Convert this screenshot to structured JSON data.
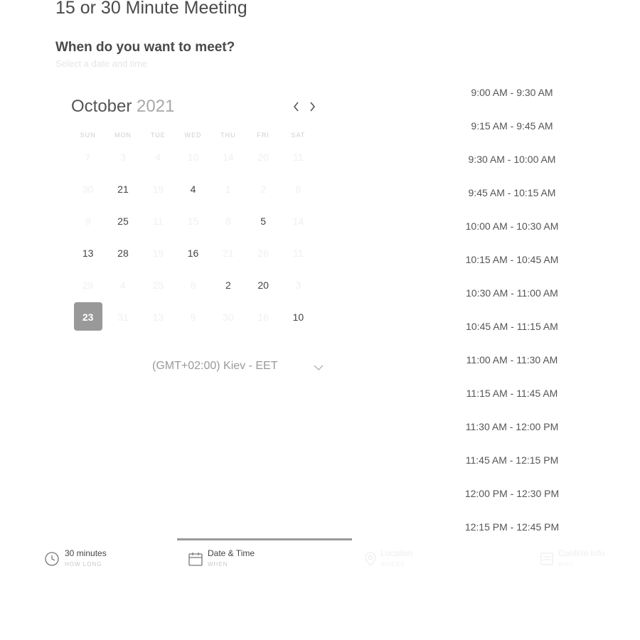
{
  "meeting": {
    "title": "15 or 30 Minute Meeting",
    "question": "When do you want to meet?",
    "subtitle": "Select a date and time"
  },
  "calendar": {
    "month": "October",
    "year": "2021",
    "prev_icon": "chevron-left-icon",
    "next_icon": "chevron-right-icon",
    "weekdays": [
      "SUN",
      "MON",
      "TUE",
      "WED",
      "THU",
      "FRI",
      "SAT"
    ],
    "days": [
      {
        "label": "7",
        "state": "disabled"
      },
      {
        "label": "3",
        "state": "disabled"
      },
      {
        "label": "4",
        "state": "disabled"
      },
      {
        "label": "10",
        "state": "disabled"
      },
      {
        "label": "14",
        "state": "disabled"
      },
      {
        "label": "20",
        "state": "disabled"
      },
      {
        "label": "11",
        "state": "disabled"
      },
      {
        "label": "30",
        "state": "disabled"
      },
      {
        "label": "21",
        "state": "enabled"
      },
      {
        "label": "19",
        "state": "disabled"
      },
      {
        "label": "4",
        "state": "enabled"
      },
      {
        "label": "1",
        "state": "disabled"
      },
      {
        "label": "2",
        "state": "disabled"
      },
      {
        "label": "8",
        "state": "disabled"
      },
      {
        "label": "9",
        "state": "disabled"
      },
      {
        "label": "25",
        "state": "enabled"
      },
      {
        "label": "11",
        "state": "disabled"
      },
      {
        "label": "15",
        "state": "disabled"
      },
      {
        "label": "8",
        "state": "disabled"
      },
      {
        "label": "5",
        "state": "enabled"
      },
      {
        "label": "14",
        "state": "disabled"
      },
      {
        "label": "13",
        "state": "enabled"
      },
      {
        "label": "28",
        "state": "enabled"
      },
      {
        "label": "19",
        "state": "disabled"
      },
      {
        "label": "16",
        "state": "enabled"
      },
      {
        "label": "21",
        "state": "disabled"
      },
      {
        "label": "26",
        "state": "disabled"
      },
      {
        "label": "11",
        "state": "disabled"
      },
      {
        "label": "29",
        "state": "disabled"
      },
      {
        "label": "4",
        "state": "disabled"
      },
      {
        "label": "25",
        "state": "disabled"
      },
      {
        "label": "8",
        "state": "disabled"
      },
      {
        "label": "2",
        "state": "enabled"
      },
      {
        "label": "20",
        "state": "enabled"
      },
      {
        "label": "3",
        "state": "disabled"
      },
      {
        "label": "23",
        "state": "selected"
      },
      {
        "label": "31",
        "state": "disabled"
      },
      {
        "label": "13",
        "state": "disabled"
      },
      {
        "label": "9",
        "state": "disabled"
      },
      {
        "label": "30",
        "state": "disabled"
      },
      {
        "label": "16",
        "state": "disabled"
      },
      {
        "label": "10",
        "state": "enabled"
      }
    ],
    "selected_color": "#999999"
  },
  "timezone": {
    "value": "(GMT+02:00) Kiev - EET",
    "icon": "chevron-down-icon"
  },
  "time_slots": [
    "9:00 AM - 9:30 AM",
    "9:15 AM - 9:45 AM",
    "9:30 AM - 10:00 AM",
    "9:45 AM - 10:15 AM",
    "10:00 AM - 10:30 AM",
    "10:15 AM - 10:45 AM",
    "10:30 AM - 11:00 AM",
    "10:45 AM - 11:15 AM",
    "11:00 AM - 11:30 AM",
    "11:15 AM - 11:45 AM",
    "11:30 AM - 12:00 PM",
    "11:45 AM - 12:15 PM",
    "12:00 PM - 12:30 PM",
    "12:15 PM - 12:45 PM"
  ],
  "steps": [
    {
      "label": "30 minutes",
      "sub": "HOW LONG",
      "icon": "clock-icon",
      "state": "done"
    },
    {
      "label": "Date & Time",
      "sub": "WHEN",
      "icon": "calendar-icon",
      "state": "active"
    },
    {
      "label": "Location",
      "sub": "WHERE",
      "icon": "location-pin-icon",
      "state": "inactive"
    },
    {
      "label": "Confirm Info",
      "sub": "WHO",
      "icon": "form-icon",
      "state": "inactive"
    }
  ]
}
